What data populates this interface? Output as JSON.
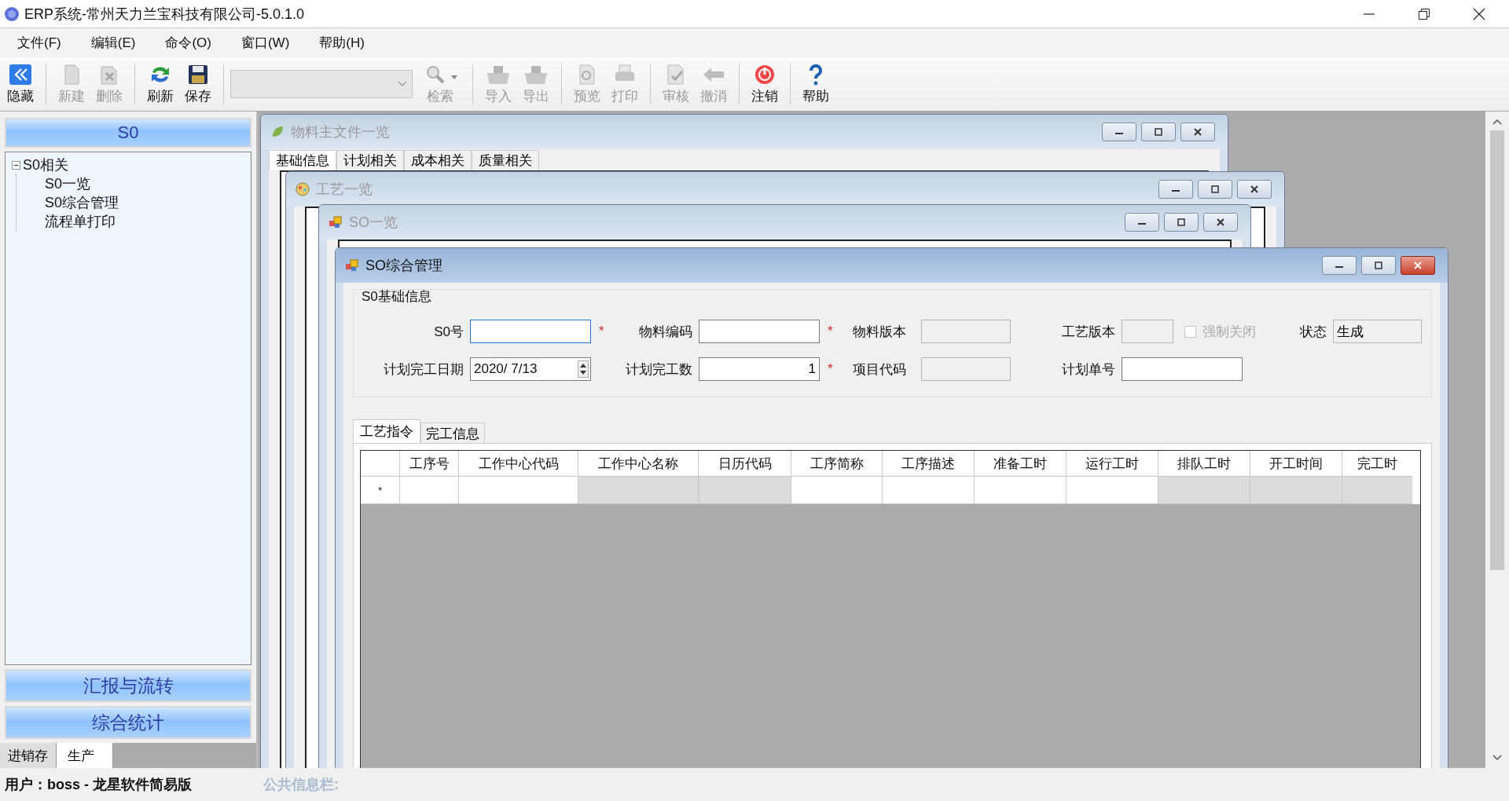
{
  "window": {
    "title": "ERP系统-常州天力兰宝科技有限公司-5.0.1.0"
  },
  "menu": [
    {
      "label": "文件(F)"
    },
    {
      "label": "编辑(E)"
    },
    {
      "label": "命令(O)"
    },
    {
      "label": "窗口(W)"
    },
    {
      "label": "帮助(H)"
    }
  ],
  "toolbar": [
    {
      "kind": "button",
      "label": "隐藏",
      "disabled": false
    },
    {
      "kind": "separator"
    },
    {
      "kind": "button",
      "label": "新建",
      "disabled": true
    },
    {
      "kind": "button",
      "label": "删除",
      "disabled": true
    },
    {
      "kind": "separator"
    },
    {
      "kind": "button",
      "label": "刷新",
      "disabled": false
    },
    {
      "kind": "button",
      "label": "保存",
      "disabled": false
    },
    {
      "kind": "separator"
    },
    {
      "kind": "combo",
      "disabled": true
    },
    {
      "kind": "split",
      "label": "检索",
      "disabled": true
    },
    {
      "kind": "separator"
    },
    {
      "kind": "button",
      "label": "导入",
      "disabled": true
    },
    {
      "kind": "button",
      "label": "导出",
      "disabled": true
    },
    {
      "kind": "separator"
    },
    {
      "kind": "button",
      "label": "预览",
      "disabled": true
    },
    {
      "kind": "button",
      "label": "打印",
      "disabled": true
    },
    {
      "kind": "separator"
    },
    {
      "kind": "button",
      "label": "审核",
      "disabled": true
    },
    {
      "kind": "button",
      "label": "撤消",
      "disabled": true
    },
    {
      "kind": "separator"
    },
    {
      "kind": "button",
      "label": "注销",
      "disabled": false
    },
    {
      "kind": "separator"
    },
    {
      "kind": "button",
      "label": "帮助",
      "disabled": false
    }
  ],
  "sidebar": {
    "header": "S0",
    "tree": [
      {
        "label": "S0相关",
        "expanded": true,
        "children": [
          {
            "label": "S0一览"
          },
          {
            "label": "S0综合管理"
          },
          {
            "label": "流程单打印"
          }
        ]
      }
    ],
    "sections": [
      "汇报与流转",
      "综合统计"
    ],
    "tabs": [
      {
        "label": "进销存",
        "selected": false
      },
      {
        "label": "生产",
        "selected": true
      }
    ]
  },
  "mdi_windows": [
    {
      "title": "物料主文件一览",
      "active": false,
      "tabs": [
        {
          "label": "基础信息",
          "selected": true
        },
        {
          "label": "计划相关",
          "selected": false
        },
        {
          "label": "成本相关",
          "selected": false
        },
        {
          "label": "质量相关",
          "selected": false
        }
      ]
    },
    {
      "title": "工艺一览",
      "active": false
    },
    {
      "title": "SO一览",
      "active": false
    }
  ],
  "form_window": {
    "title": "SO综合管理",
    "active": true,
    "group_title": "S0基础信息",
    "rows": [
      [
        {
          "kind": "text",
          "label": "S0号",
          "focused": true,
          "readonly": false,
          "required_mark": "*"
        },
        {
          "kind": "text",
          "label": "物料编码",
          "focused": false,
          "readonly": false,
          "required_mark": "*"
        },
        {
          "kind": "text",
          "label": "物料版本",
          "focused": false,
          "readonly": true
        },
        {
          "kind": "text",
          "label": "工艺版本",
          "focused": false,
          "readonly": true
        },
        {
          "kind": "checkbox",
          "label": "强制关闭",
          "checked": false,
          "disabled": true
        },
        {
          "kind": "text",
          "label": "状态",
          "value": "生成",
          "focused": false,
          "readonly": true
        }
      ],
      [
        {
          "kind": "date",
          "label": "计划完工日期",
          "value": "2020/ 7/13"
        },
        {
          "kind": "number",
          "label": "计划完工数",
          "value": "1",
          "focused": false,
          "readonly": false,
          "required_mark": "*"
        },
        {
          "kind": "text",
          "label": "项目代码",
          "focused": false,
          "readonly": true
        },
        {
          "kind": "text",
          "label": "计划单号",
          "focused": false,
          "readonly": false
        }
      ]
    ],
    "tabs": [
      {
        "label": "工艺指令",
        "selected": true
      },
      {
        "label": "完工信息",
        "selected": false
      }
    ],
    "grid": {
      "new_row_marker": "*",
      "columns": [
        {
          "label": "工序号",
          "readonly": false
        },
        {
          "label": "工作中心代码",
          "readonly": false
        },
        {
          "label": "工作中心名称",
          "readonly": true
        },
        {
          "label": "日历代码",
          "readonly": true
        },
        {
          "label": "工序简称",
          "readonly": false
        },
        {
          "label": "工序描述",
          "readonly": false
        },
        {
          "label": "准备工时",
          "readonly": false
        },
        {
          "label": "运行工时",
          "readonly": false
        },
        {
          "label": "排队工时",
          "readonly": true
        },
        {
          "label": "开工时间",
          "readonly": true
        },
        {
          "label": "完工时",
          "readonly": true
        }
      ]
    }
  },
  "status_bar": {
    "user": "用户：boss - 龙星软件简易版",
    "info_label": "公共信息栏:"
  }
}
